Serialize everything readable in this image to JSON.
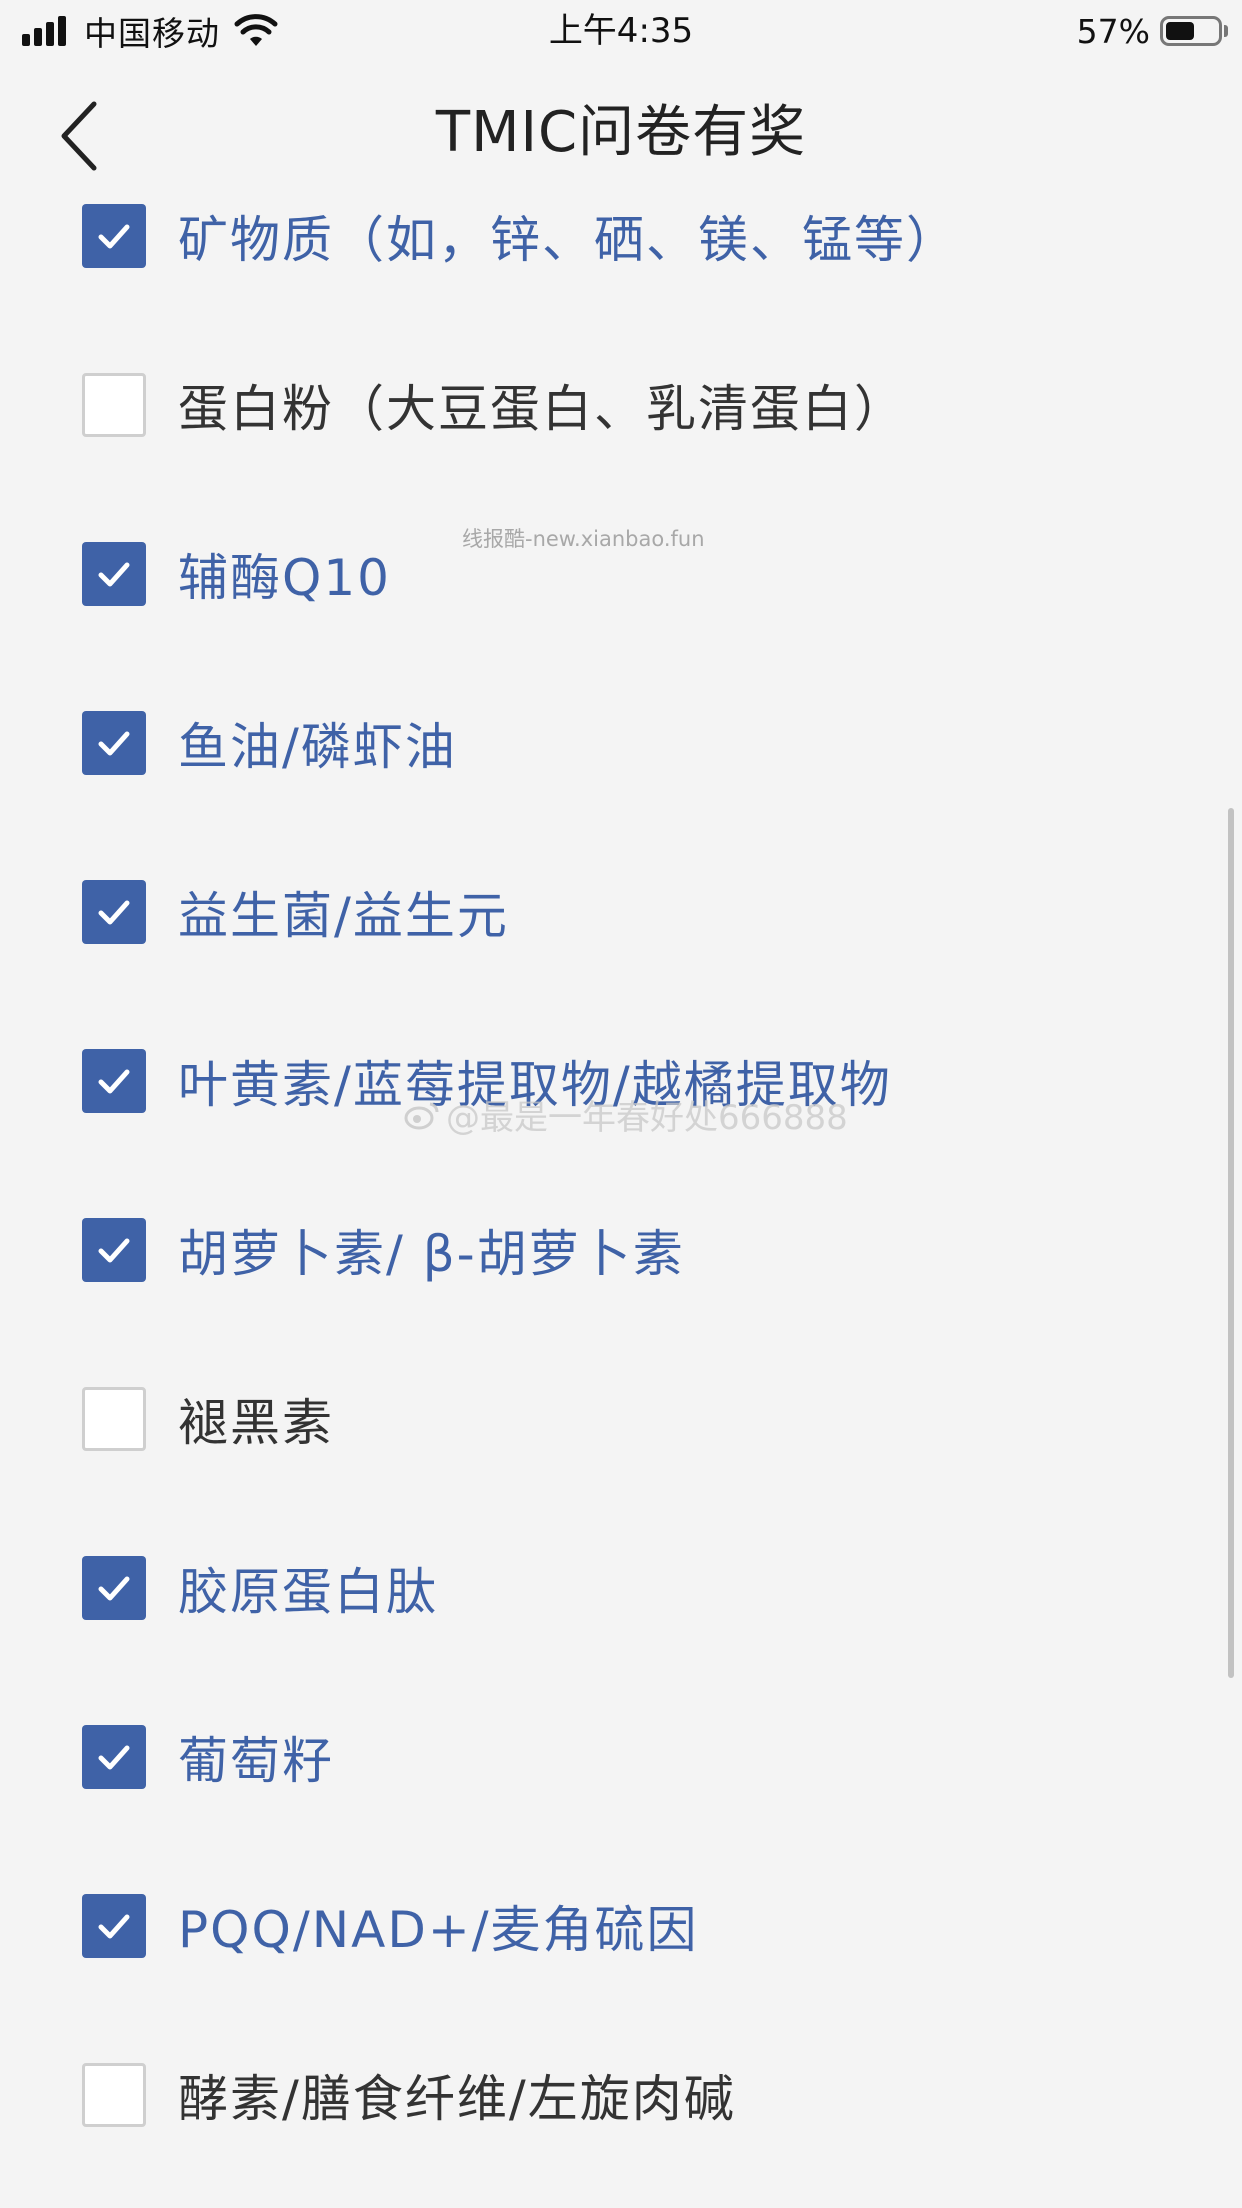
{
  "status_bar": {
    "carrier": "中国移动",
    "time": "上午4:35",
    "battery_percent": "57%",
    "battery_level": 0.57
  },
  "nav": {
    "title": "TMIC问卷有奖",
    "back_icon": "chevron-left-icon"
  },
  "colors": {
    "accent": "#3f62a7",
    "text_default": "#333333",
    "checkbox_border": "#cfcfcf"
  },
  "options": [
    {
      "label": "矿物质（如，锌、硒、镁、锰等）",
      "checked": true
    },
    {
      "label": "蛋白粉（大豆蛋白、乳清蛋白）",
      "checked": false
    },
    {
      "label": "辅酶Q10",
      "checked": true
    },
    {
      "label": "鱼油/磷虾油",
      "checked": true
    },
    {
      "label": "益生菌/益生元",
      "checked": true
    },
    {
      "label": "叶黄素/蓝莓提取物/越橘提取物",
      "checked": true
    },
    {
      "label": "胡萝卜素/ β-胡萝卜素",
      "checked": true
    },
    {
      "label": "褪黑素",
      "checked": false
    },
    {
      "label": "胶原蛋白肽",
      "checked": true
    },
    {
      "label": "葡萄籽",
      "checked": true
    },
    {
      "label": "PQQ/NAD+/麦角硫因",
      "checked": true
    },
    {
      "label": "酵素/膳食纤维/左旋肉碱",
      "checked": false
    }
  ],
  "watermarks": {
    "site": "线报酷-new.xianbao.fun",
    "weibo": "@最是一年春好处666888"
  }
}
